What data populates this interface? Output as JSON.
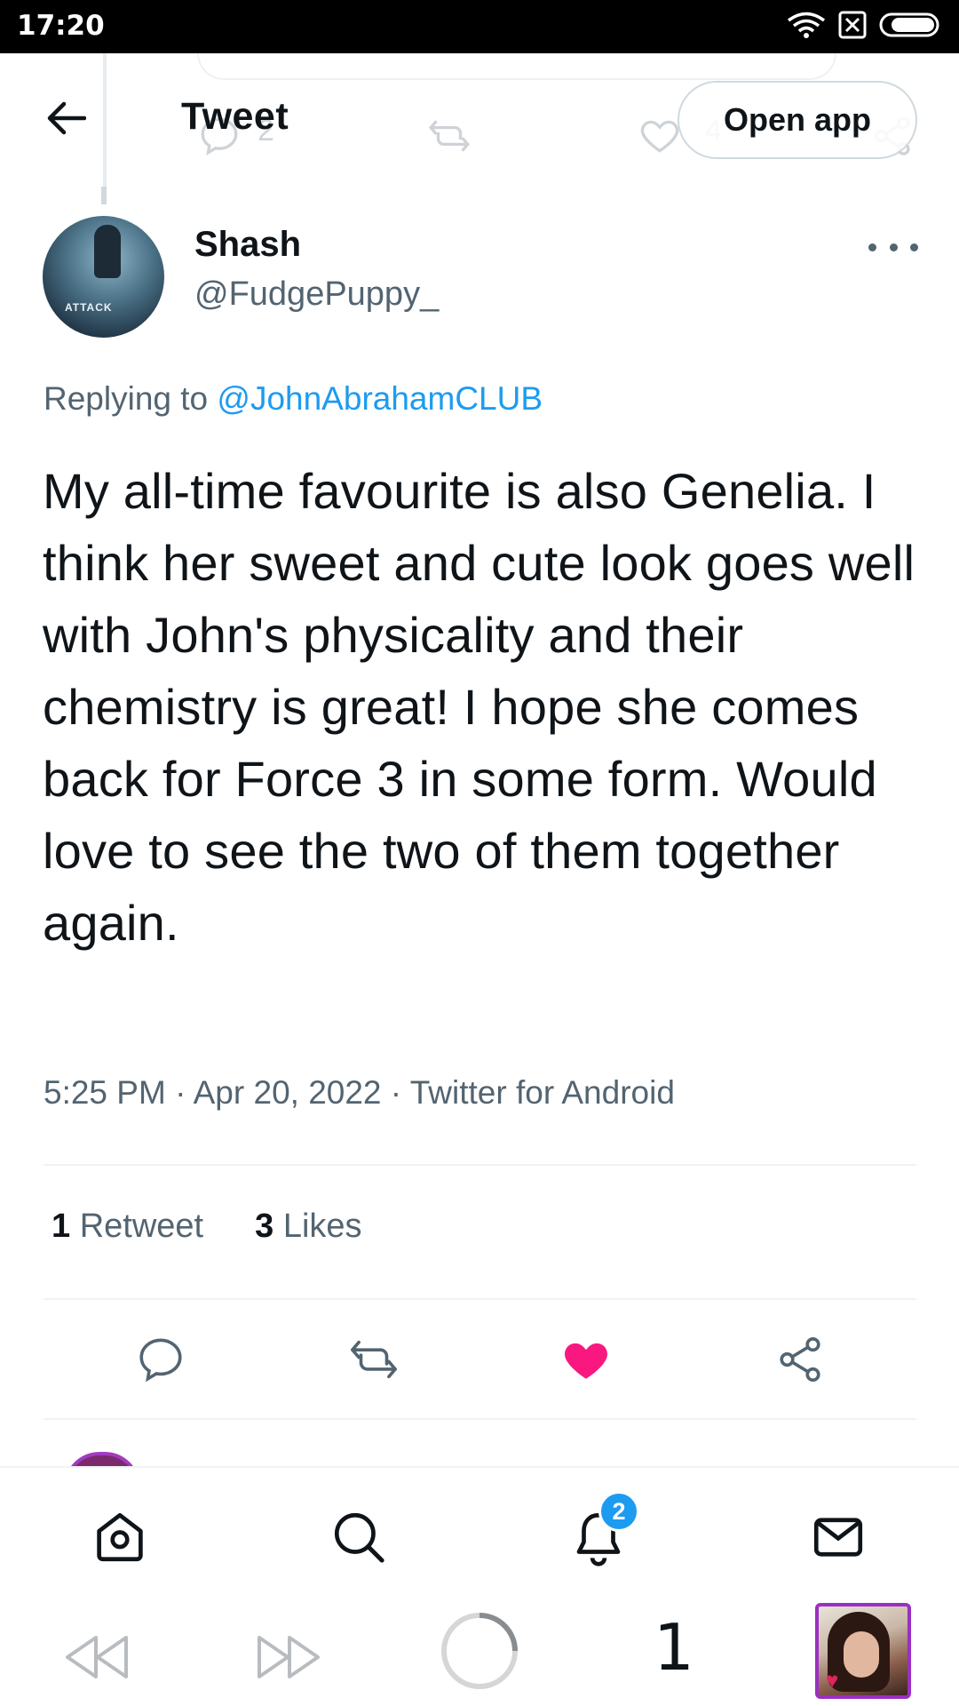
{
  "status_bar": {
    "time": "17:20"
  },
  "header": {
    "title": "Tweet",
    "open_app_label": "Open app"
  },
  "ghost_counts": {
    "replies": "2",
    "likes": "4"
  },
  "tweet": {
    "display_name": "Shash",
    "handle": "@FudgePuppy_",
    "avatar_text": "ATTACK",
    "replying_prefix": "Replying to ",
    "replying_to": "@JohnAbrahamCLUB",
    "text": "My all-time favourite is also Genelia. I think her sweet and cute look goes well with John's physicality and their chemistry is great! I hope she comes back for Force 3 in some form. Would love to see the two of them together again.",
    "meta": "5:25 PM · Apr 20, 2022 · Twitter for Android",
    "retweet_count": "1",
    "retweet_label": "Retweet",
    "like_count": "3",
    "like_label": "Likes"
  },
  "bottom_nav": {
    "notification_badge": "2"
  },
  "system_nav": {
    "tab_count": "1"
  },
  "colors": {
    "accent": "#1d9bf0",
    "like": "#f91880",
    "text": "#0f1419",
    "secondary": "#536471"
  },
  "icons": [
    "back-arrow-icon",
    "more-icon",
    "reply-icon",
    "retweet-icon",
    "like-icon",
    "share-icon",
    "home-icon",
    "search-icon",
    "notifications-icon",
    "messages-icon"
  ]
}
